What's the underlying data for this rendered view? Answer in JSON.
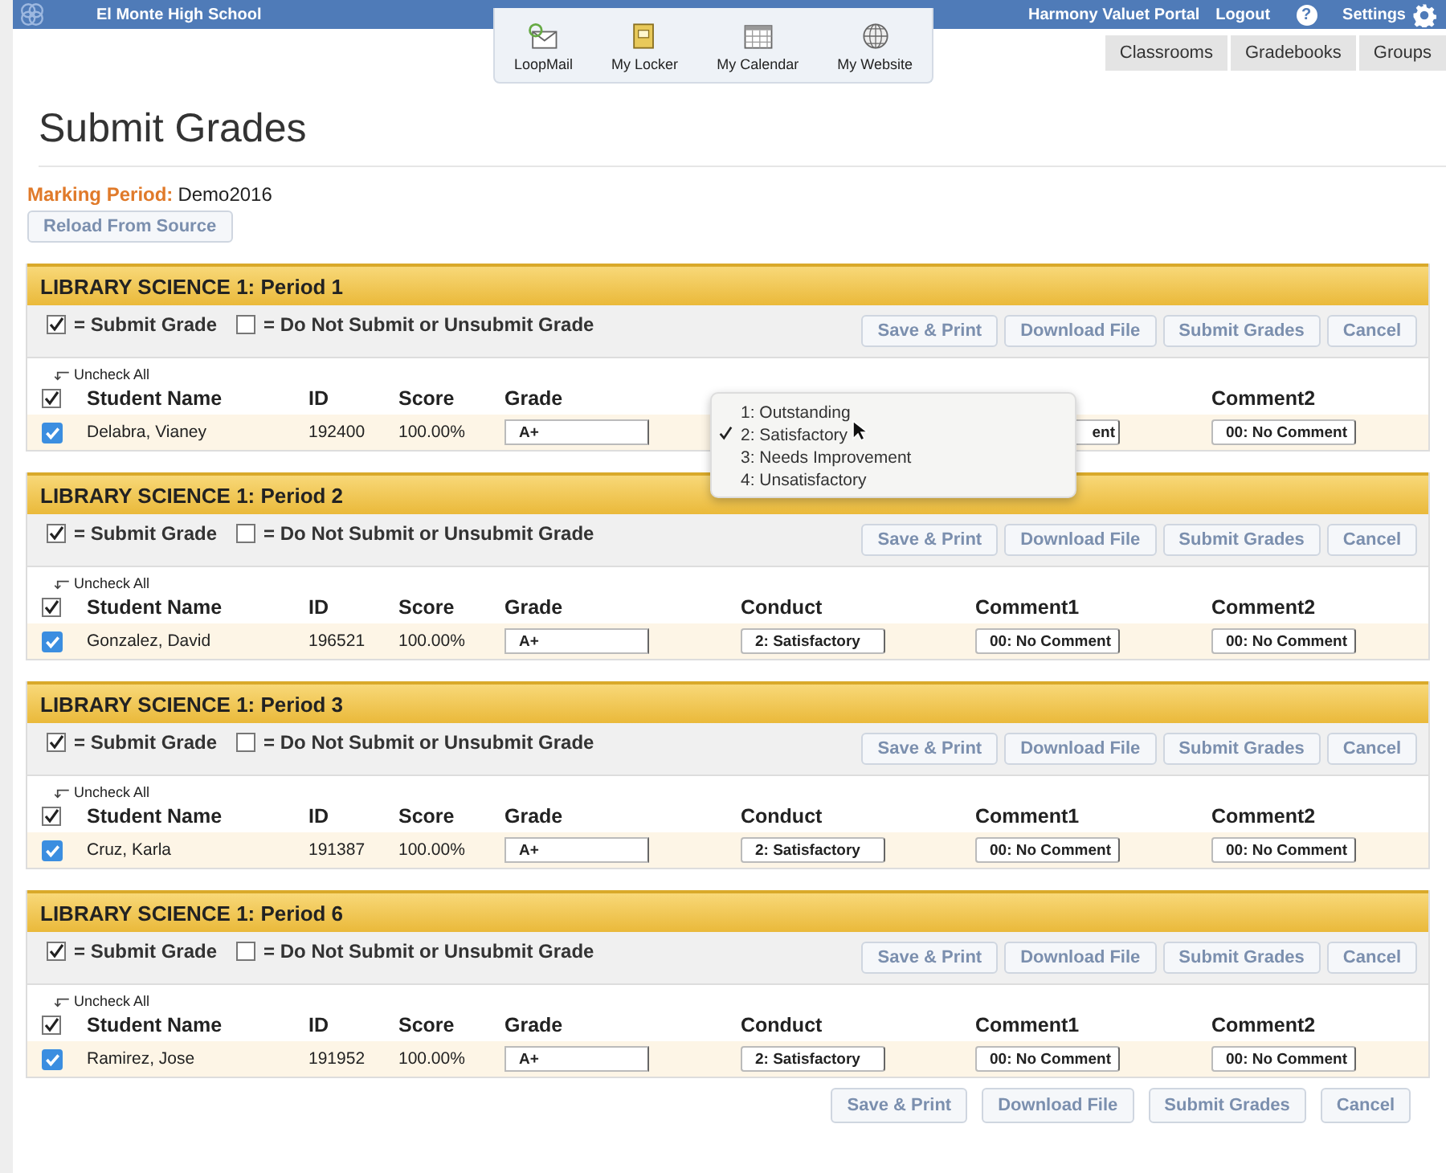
{
  "topbar": {
    "school": "El Monte High School",
    "portal": "Harmony Valuet Portal",
    "logout": "Logout",
    "help": "?",
    "settings": "Settings"
  },
  "apps": [
    {
      "kind": "mail",
      "label": "LoopMail"
    },
    {
      "kind": "locker",
      "label": "My Locker"
    },
    {
      "kind": "calendar",
      "label": "My Calendar"
    },
    {
      "kind": "website",
      "label": "My Website"
    }
  ],
  "nav_tabs": [
    {
      "label": "Classrooms",
      "selected": false
    },
    {
      "label": "Gradebooks",
      "selected": false
    },
    {
      "label": "Groups",
      "selected": false
    }
  ],
  "title": "Submit Grades",
  "marking_period": {
    "label": "Marking Period:",
    "value": "Demo2016"
  },
  "reload_button": "Reload From Source",
  "sections": [
    {
      "title": "LIBRARY SCIENCE 1: Period 1",
      "legend": [
        {
          "checked": true,
          "text": "= Submit Grade"
        },
        {
          "checked": false,
          "text": "= Do Not Submit or Unsubmit Grade"
        }
      ],
      "buttons": [
        "Save & Print",
        "Download File",
        "Submit Grades",
        "Cancel"
      ],
      "uncheck_all": "Uncheck All",
      "header_checked": true,
      "headers": {
        "name": "Student Name",
        "id": "ID",
        "score": "Score",
        "grade": "Grade",
        "comment2": "Comment2"
      },
      "rows": [
        {
          "checked": true,
          "name": "Delabra, Vianey",
          "id": "192400",
          "score": "100.00%",
          "grade": "A+",
          "comment1": "ent",
          "comment2": "00: No Comment"
        }
      ]
    },
    {
      "title": "LIBRARY SCIENCE 1: Period 2",
      "legend": [
        {
          "checked": true,
          "text": "= Submit Grade"
        },
        {
          "checked": false,
          "text": "= Do Not Submit or Unsubmit Grade"
        }
      ],
      "buttons": [
        "Save & Print",
        "Download File",
        "Submit Grades",
        "Cancel"
      ],
      "uncheck_all": "Uncheck All",
      "header_checked": true,
      "headers": {
        "name": "Student Name",
        "id": "ID",
        "score": "Score",
        "grade": "Grade",
        "conduct": "Conduct",
        "comment1": "Comment1",
        "comment2": "Comment2"
      },
      "rows": [
        {
          "checked": true,
          "name": "Gonzalez, David",
          "id": "196521",
          "score": "100.00%",
          "grade": "A+",
          "conduct": "2: Satisfactory",
          "comment1": "00: No Comment",
          "comment2": "00: No Comment"
        }
      ]
    },
    {
      "title": "LIBRARY SCIENCE 1: Period 3",
      "legend": [
        {
          "checked": true,
          "text": "= Submit Grade"
        },
        {
          "checked": false,
          "text": "= Do Not Submit or Unsubmit Grade"
        }
      ],
      "buttons": [
        "Save & Print",
        "Download File",
        "Submit Grades",
        "Cancel"
      ],
      "uncheck_all": "Uncheck All",
      "header_checked": true,
      "headers": {
        "name": "Student Name",
        "id": "ID",
        "score": "Score",
        "grade": "Grade",
        "conduct": "Conduct",
        "comment1": "Comment1",
        "comment2": "Comment2"
      },
      "rows": [
        {
          "checked": true,
          "name": "Cruz, Karla",
          "id": "191387",
          "score": "100.00%",
          "grade": "A+",
          "conduct": "2: Satisfactory",
          "comment1": "00: No Comment",
          "comment2": "00: No Comment"
        }
      ]
    },
    {
      "title": "LIBRARY SCIENCE 1: Period 6",
      "legend": [
        {
          "checked": true,
          "text": "= Submit Grade"
        },
        {
          "checked": false,
          "text": "= Do Not Submit or Unsubmit Grade"
        }
      ],
      "buttons": [
        "Save & Print",
        "Download File",
        "Submit Grades",
        "Cancel"
      ],
      "uncheck_all": "Uncheck All",
      "header_checked": true,
      "headers": {
        "name": "Student Name",
        "id": "ID",
        "score": "Score",
        "grade": "Grade",
        "conduct": "Conduct",
        "comment1": "Comment1",
        "comment2": "Comment2"
      },
      "rows": [
        {
          "checked": true,
          "name": "Ramirez, Jose",
          "id": "191952",
          "score": "100.00%",
          "grade": "A+",
          "conduct": "2: Satisfactory",
          "comment1": "00: No Comment",
          "comment2": "00: No Comment"
        }
      ]
    }
  ],
  "conduct_dropdown": [
    {
      "label": "1: Outstanding",
      "selected": false
    },
    {
      "label": "2: Satisfactory",
      "selected": true
    },
    {
      "label": "3: Needs Improvement",
      "selected": false
    },
    {
      "label": "4: Unsatisfactory",
      "selected": false
    }
  ],
  "bottom_buttons": [
    "Save & Print",
    "Download File",
    "Submit Grades",
    "Cancel"
  ]
}
